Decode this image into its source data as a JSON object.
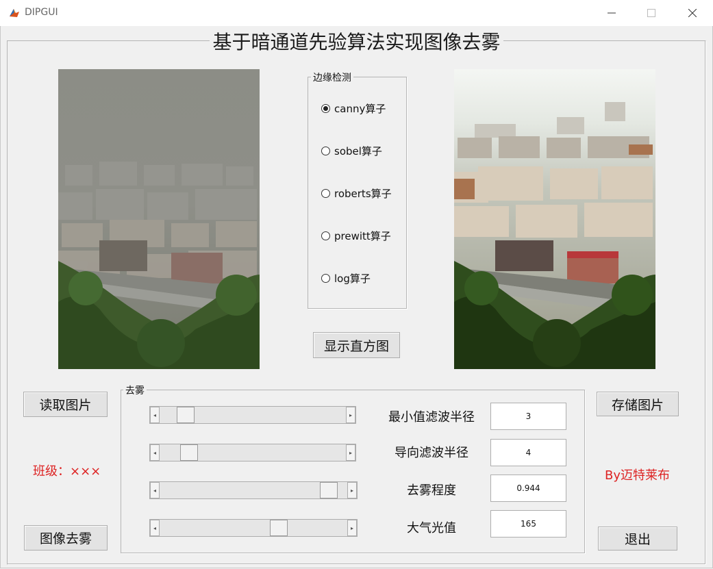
{
  "window": {
    "title": "DIPGUI"
  },
  "page": {
    "title": "基于暗通道先验算法实现图像去雾"
  },
  "edge_detection": {
    "legend": "边缘检测",
    "options": [
      {
        "label": "canny算子",
        "selected": true
      },
      {
        "label": "sobel算子",
        "selected": false
      },
      {
        "label": "roberts算子",
        "selected": false
      },
      {
        "label": "prewitt算子",
        "selected": false
      },
      {
        "label": "log算子",
        "selected": false
      }
    ]
  },
  "buttons": {
    "histogram": "显示直方图",
    "read_image": "读取图片",
    "dehaze": "图像去雾",
    "save_image": "存储图片",
    "exit": "退出"
  },
  "info": {
    "class_label": "班级：×××",
    "author": "By迈特莱布"
  },
  "dehaze_panel": {
    "legend": "去雾",
    "params": [
      {
        "label": "最小值滤波半径",
        "value": "3",
        "slider_fraction": 0.1
      },
      {
        "label": "导向滤波半径",
        "value": "4",
        "slider_fraction": 0.12
      },
      {
        "label": "去雾程度",
        "value": "0.944",
        "slider_fraction": 0.944
      },
      {
        "label": "大气光值",
        "value": "165",
        "slider_fraction": 0.65
      }
    ]
  },
  "colors": {
    "accent_red": "#dd2222",
    "panel_bg": "#f0f0f0"
  }
}
